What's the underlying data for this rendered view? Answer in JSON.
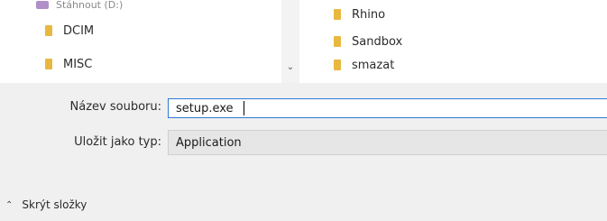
{
  "navigation_pane": {
    "items": [
      {
        "label": "Stáhnout (D:)",
        "icon": "drive-icon"
      },
      {
        "label": "DCIM",
        "icon": "folder-icon"
      },
      {
        "label": "MISC",
        "icon": "folder-icon"
      }
    ]
  },
  "content_pane": {
    "items": [
      {
        "label": "Rhino",
        "icon": "folder-icon"
      },
      {
        "label": "Sandbox",
        "icon": "folder-icon"
      },
      {
        "label": "smazat",
        "icon": "folder-icon"
      }
    ]
  },
  "form": {
    "filename_label": "Název souboru:",
    "filename_value": "setup.exe",
    "type_label": "Uložit jako typ:",
    "type_value": "Application"
  },
  "footer": {
    "hide_folders_label": "Skrýt složky"
  },
  "colors": {
    "folder": "#e8b83f",
    "focus_border": "#2f7bd6",
    "background": "#f0f0f0"
  }
}
